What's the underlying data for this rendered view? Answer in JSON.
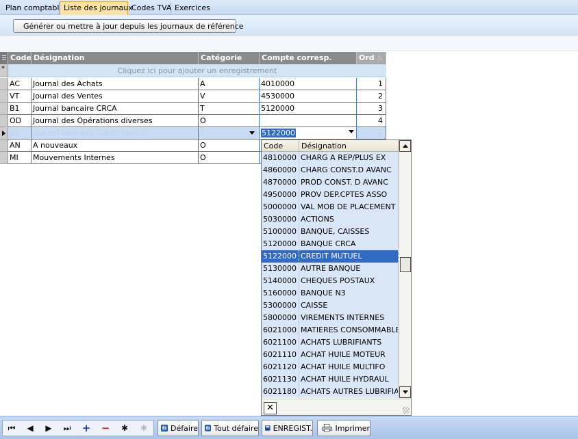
{
  "tabs": [
    {
      "label": "Plan comptable",
      "active": false
    },
    {
      "label": "Liste des journaux",
      "active": true
    },
    {
      "label": "Codes TVA",
      "active": false
    },
    {
      "label": "Exercices",
      "active": false
    }
  ],
  "toolbar": {
    "generate_label": "Générer ou mettre à jour depuis les journaux de référence"
  },
  "grid": {
    "columns": [
      "Code",
      "Désignation",
      "Catégorie",
      "Compte corresp.",
      "Ord"
    ],
    "new_row_hint": "Cliquez ici pour ajouter un enregistrement",
    "rows": [
      {
        "code": "AC",
        "designation": "Journal des Achats",
        "categorie": "A",
        "compte": "4010000",
        "ord": "1"
      },
      {
        "code": "VT",
        "designation": "Journal des Ventes",
        "categorie": "V",
        "compte": "4530000",
        "ord": "2"
      },
      {
        "code": "B1",
        "designation": "Journal bancaire CRCA",
        "categorie": "T",
        "compte": "5120000",
        "ord": "3"
      },
      {
        "code": "OD",
        "designation": "Journal des Opérations diverses",
        "categorie": "O",
        "compte": "",
        "ord": "4"
      },
      {
        "code": "B2",
        "designation": "Journal bancaire Crédit Mutuel",
        "categorie": "T",
        "compte": "5122000",
        "ord": "5"
      },
      {
        "code": "AN",
        "designation": "A nouveaux",
        "categorie": "O",
        "compte": "",
        "ord": ""
      },
      {
        "code": "MI",
        "designation": "Mouvements Internes",
        "categorie": "O",
        "compte": "",
        "ord": ""
      }
    ]
  },
  "dropdown": {
    "columns": [
      "Code",
      "Désignation"
    ],
    "selected_code": "5122000",
    "items": [
      {
        "code": "4810000",
        "designation": "CHARG A REP/PLUS EX"
      },
      {
        "code": "4860000",
        "designation": "CHARG CONST.D AVANC"
      },
      {
        "code": "4870000",
        "designation": "PROD CONST. D AVANC"
      },
      {
        "code": "4950000",
        "designation": "PROV DEP.CPTES ASSO"
      },
      {
        "code": "5000000",
        "designation": "VAL MOB DE PLACEMENT"
      },
      {
        "code": "5030000",
        "designation": "ACTIONS"
      },
      {
        "code": "5100000",
        "designation": "BANQUE, CAISSES"
      },
      {
        "code": "5120000",
        "designation": "BANQUE CRCA"
      },
      {
        "code": "5122000",
        "designation": "CREDIT MUTUEL"
      },
      {
        "code": "5130000",
        "designation": "AUTRE BANQUE"
      },
      {
        "code": "5140000",
        "designation": "CHEQUES POSTAUX"
      },
      {
        "code": "5160000",
        "designation": "BANQUE N3"
      },
      {
        "code": "5300000",
        "designation": "CAISSE"
      },
      {
        "code": "5800000",
        "designation": "VIREMENTS INTERNES"
      },
      {
        "code": "6021000",
        "designation": "MATIERES CONSOMMABLES"
      },
      {
        "code": "6021100",
        "designation": "ACHATS LUBRIFIANTS"
      },
      {
        "code": "6021110",
        "designation": "ACHAT HUILE MOTEUR"
      },
      {
        "code": "6021120",
        "designation": "ACHAT HUILE MULTIFO"
      },
      {
        "code": "6021130",
        "designation": "ACHAT HUILE HYDRAUL"
      },
      {
        "code": "6021180",
        "designation": "ACHATS AUTRES LUBRIFIANTS"
      }
    ],
    "close_glyph": "✕"
  },
  "navigator": {
    "first": "⏮",
    "prev": "◀",
    "next": "▶",
    "last": "⏭",
    "add": "+",
    "delete": "−",
    "post": "✱",
    "cancel": "✱"
  },
  "buttons": {
    "undo": "Défaire",
    "undo_all": "Tout défaire",
    "save": "ENREGIST.",
    "print": "Imprimer"
  },
  "colors": {
    "active_tab": "#fbe3a4",
    "header_gray": "#8a8a8a",
    "selection_blue": "#316ac5",
    "grid_line": "#4a7bbd"
  }
}
